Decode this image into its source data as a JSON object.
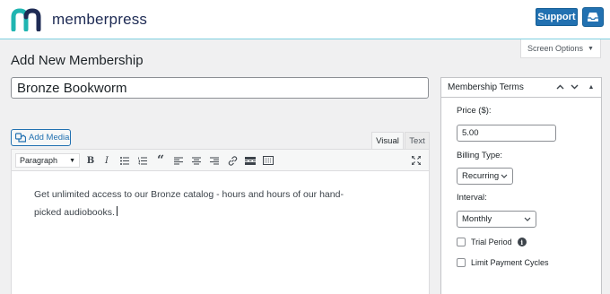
{
  "header": {
    "brand_name": "memberpress",
    "support_label": "Support",
    "inbox_icon": "inbox-icon"
  },
  "screen_options": {
    "label": "Screen Options"
  },
  "page_title": "Add New Membership",
  "title_field": {
    "value": "Bronze Bookworm"
  },
  "editor": {
    "add_media_label": "Add Media",
    "tabs": {
      "visual": "Visual",
      "text": "Text"
    },
    "format_select": "Paragraph",
    "toolbar_icons": [
      "bold-icon",
      "italic-icon",
      "bullet-list-icon",
      "numbered-list-icon",
      "blockquote-icon",
      "align-left-icon",
      "align-center-icon",
      "align-right-icon",
      "link-icon",
      "read-more-icon",
      "toolbar-toggle-icon",
      "fullscreen-icon"
    ],
    "content": "Get unlimited access to our Bronze catalog - hours and hours of our hand-picked audiobooks."
  },
  "membership_terms": {
    "title": "Membership Terms",
    "price_label": "Price ($):",
    "price_value": "5.00",
    "billing_label": "Billing Type:",
    "billing_value": "Recurring",
    "interval_label": "Interval:",
    "interval_value": "Monthly",
    "trial_label": "Trial Period",
    "limit_label": "Limit Payment Cycles"
  },
  "colors": {
    "accent": "#2271b1",
    "brand_teal": "#1fb5b1",
    "brand_navy": "#1e2b54"
  }
}
